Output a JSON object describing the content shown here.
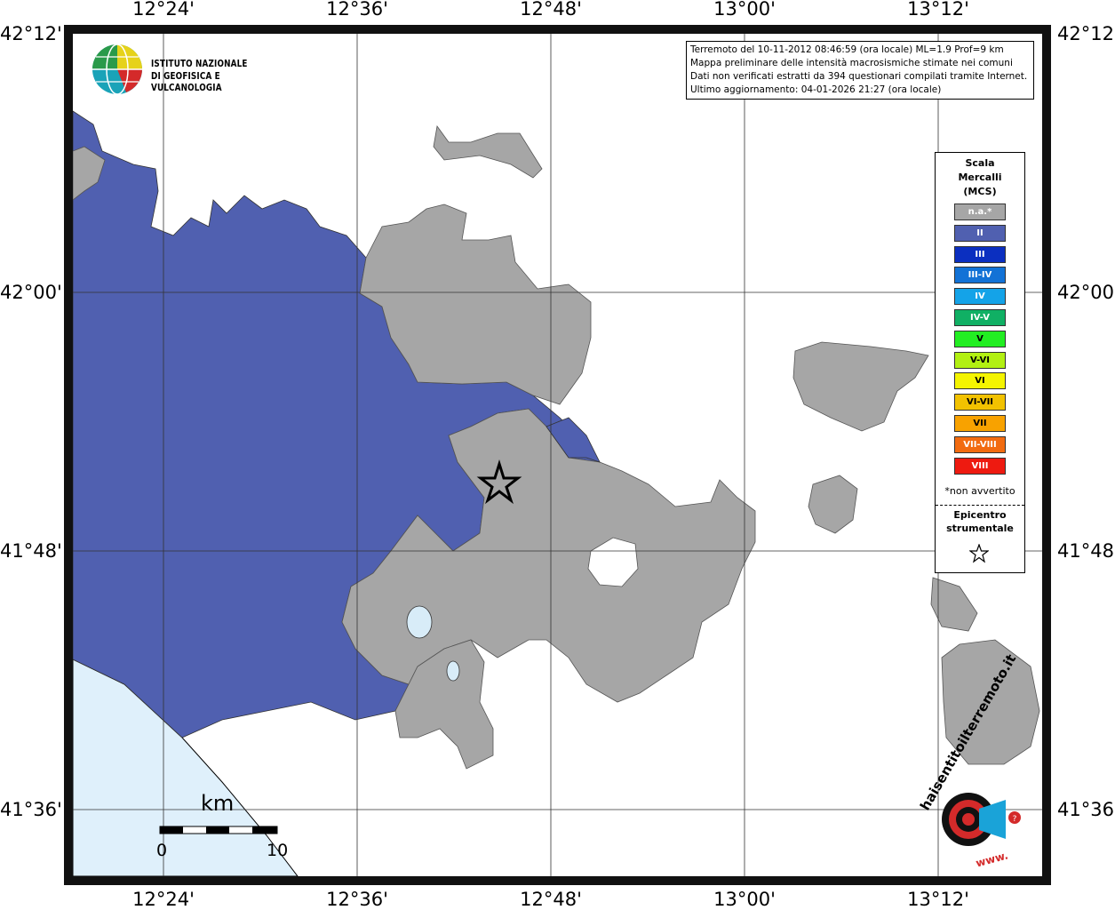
{
  "axes": {
    "lon_ticks": [
      "12°24'",
      "12°36'",
      "12°48'",
      "13°00'",
      "13°12'"
    ],
    "lat_ticks": [
      "42°12'",
      "42°00'",
      "41°48'",
      "41°36'"
    ]
  },
  "logo": {
    "line1": "ISTITUTO NAZIONALE",
    "line2": "DI GEOFISICA E VULCANOLOGIA"
  },
  "info": {
    "line1": "Terremoto del 10-11-2012 08:46:59 (ora locale) ML=1.9 Prof=9 km",
    "line2": "Mappa preliminare delle intensità macrosismiche stimate nei comuni",
    "line3": "Dati non verificati estratti da 394 questionari compilati tramite Internet.",
    "line4": "Ultimo aggiornamento: 04-01-2026 21:27 (ora locale)"
  },
  "legend": {
    "title1": "Scala",
    "title2": "Mercalli",
    "title3": "(MCS)",
    "items": [
      {
        "label": "n.a.*",
        "color": "#a6a6a6"
      },
      {
        "label": "II",
        "color": "#5060b0"
      },
      {
        "label": "III",
        "color": "#0b2fc0"
      },
      {
        "label": "III-IV",
        "color": "#1272d6"
      },
      {
        "label": "IV",
        "color": "#14a3e8"
      },
      {
        "label": "IV-V",
        "color": "#10b064"
      },
      {
        "label": "V",
        "color": "#22ee22"
      },
      {
        "label": "V-VI",
        "color": "#b2f012"
      },
      {
        "label": "VI",
        "color": "#f4f400"
      },
      {
        "label": "VI-VII",
        "color": "#f2c200"
      },
      {
        "label": "VII",
        "color": "#f8a200"
      },
      {
        "label": "VII-VIII",
        "color": "#f26b10"
      },
      {
        "label": "VIII",
        "color": "#ee1a10"
      }
    ],
    "note": "*non avvertito",
    "epi1": "Epicentro",
    "epi2": "strumentale"
  },
  "scalebar": {
    "unit": "km",
    "min": "0",
    "max": "10"
  },
  "badge": {
    "text1": "haisentitoilterremoto.it",
    "text2": "www."
  },
  "colors": {
    "sea": "#dff0fb",
    "grey": "#a6a6a6",
    "blue": "#5060b0",
    "lake": "#d8ecf8"
  }
}
